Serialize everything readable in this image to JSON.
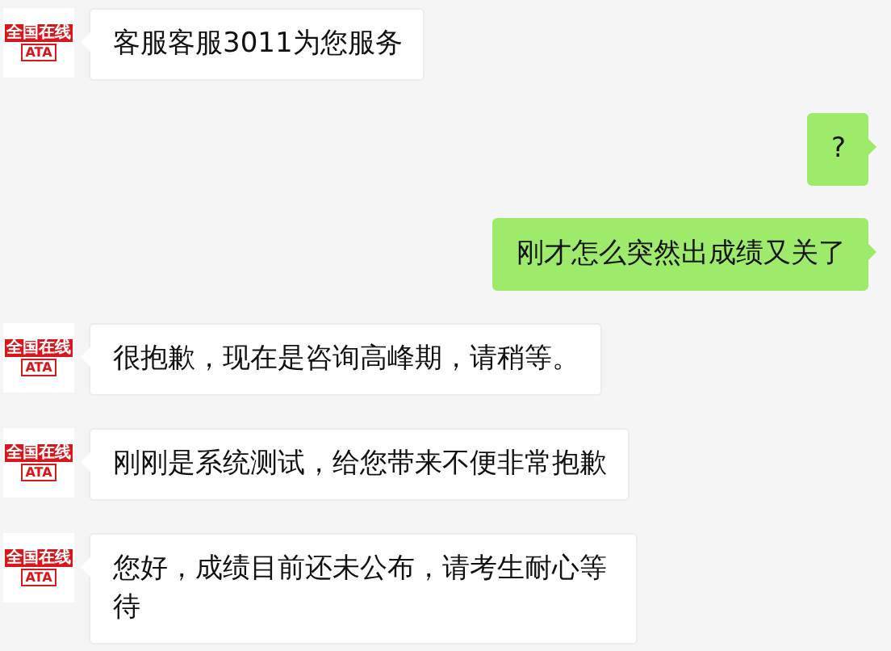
{
  "messages": [
    {
      "kind": "received",
      "avatar": {
        "name": "全国在线",
        "tag": "ATA"
      },
      "text": "客服客服3011为您服务"
    },
    {
      "kind": "sent",
      "text": "?"
    },
    {
      "kind": "sent",
      "text": "刚才怎么突然出成绩又关了"
    },
    {
      "kind": "received",
      "avatar": {
        "name": "全国在线",
        "tag": "ATA"
      },
      "text": "很抱歉，现在是咨询高峰期，请稍等。"
    },
    {
      "kind": "received",
      "avatar": {
        "name": "全国在线",
        "tag": "ATA"
      },
      "text": "刚刚是系统测试，给您带来不便非常抱歉"
    },
    {
      "kind": "received",
      "avatar": {
        "name": "全国在线",
        "tag": "ATA"
      },
      "text": "您好，成绩目前还未公布，请考生耐心等待"
    }
  ]
}
